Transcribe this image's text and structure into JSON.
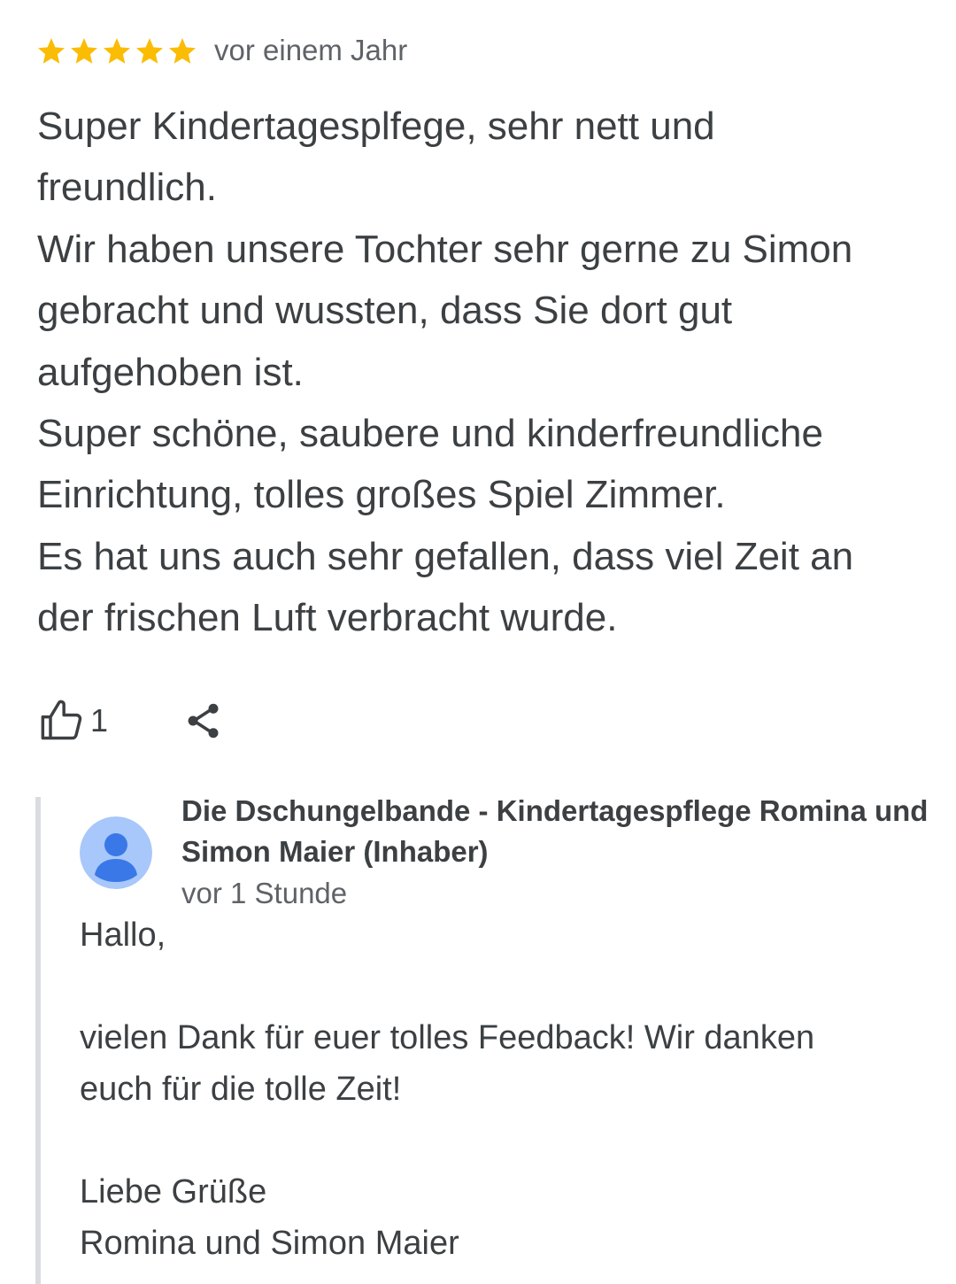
{
  "review": {
    "rating": 5,
    "max_rating": 5,
    "star_color": "#fbbc04",
    "time": "vor einem Jahr",
    "lines": [
      "Super Kindertagesplfege, sehr nett und",
      "freundlich.",
      "Wir haben unsere Tochter sehr gerne zu Simon",
      "gebracht und wussten, dass Sie dort gut",
      "aufgehoben ist.",
      "Super schöne, saubere und kinderfreundliche",
      "Einrichtung, tolles großes Spiel Zimmer.",
      "Es hat uns auch sehr gefallen, dass viel Zeit an",
      "der frischen Luft verbracht wurde."
    ]
  },
  "actions": {
    "like_icon": "thumb-up-icon",
    "like_count": "1",
    "share_icon": "share-icon"
  },
  "reply": {
    "avatar_icon": "person-icon",
    "owner_name_line1": "Die Dschungelbande - Kindertagespflege Romina und",
    "owner_name_line2": "Simon Maier (Inhaber)",
    "time": "vor 1 Stunde",
    "lines": [
      "Hallo,",
      "",
      "vielen Dank für euer tolles Feedback! Wir danken",
      "euch für die tolle Zeit!",
      "",
      "Liebe Grüße",
      "Romina und Simon Maier"
    ]
  }
}
